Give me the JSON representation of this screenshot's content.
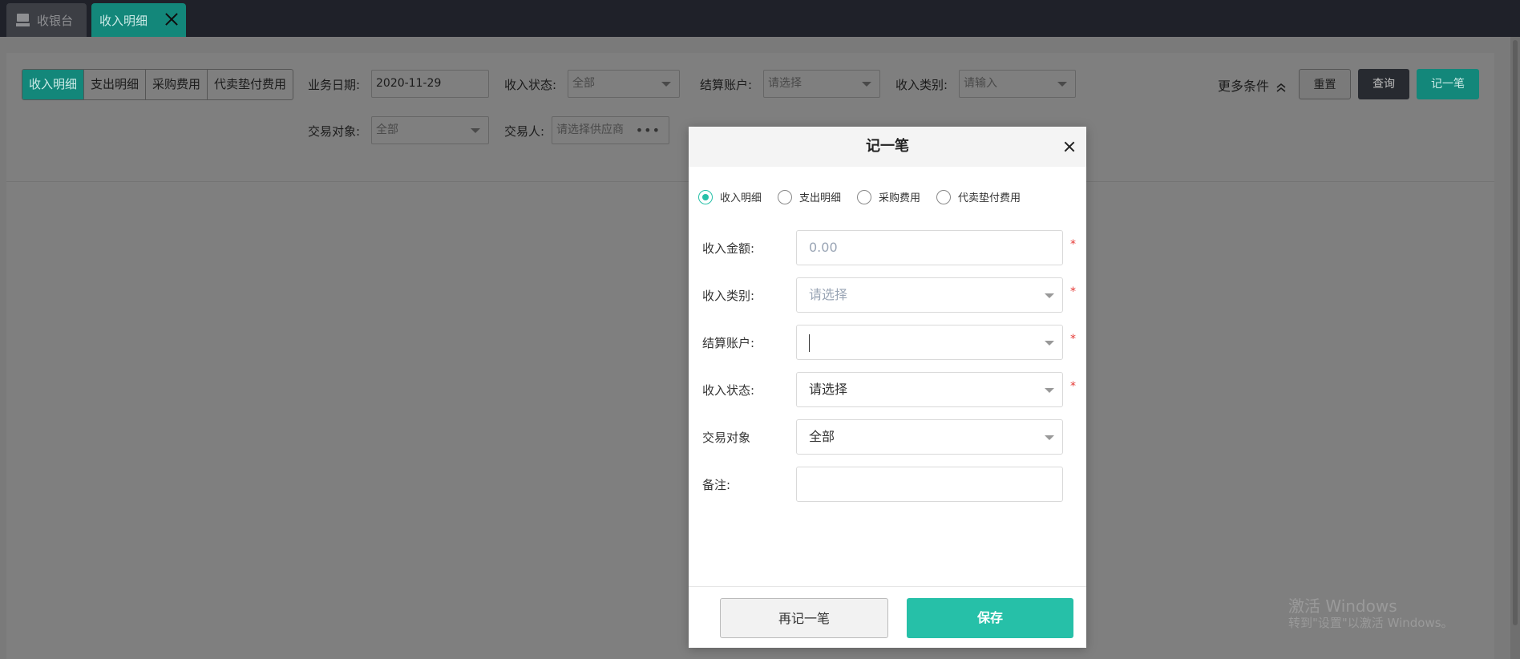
{
  "tabs": [
    {
      "label": "收银台",
      "icon": "cash-register-icon"
    },
    {
      "label": "收入明细",
      "active": true
    }
  ],
  "filter": {
    "segments": [
      "收入明细",
      "支出明细",
      "采购费用",
      "代卖垫付费用"
    ],
    "active_segment": "收入明细",
    "biz_date_label": "业务日期:",
    "biz_date_value": "2020-11-29",
    "income_status_label": "收入状态:",
    "income_status_value": "全部",
    "account_label": "结算账户:",
    "account_placeholder": "请选择",
    "category_label": "收入类别:",
    "category_placeholder": "请输入",
    "object_label": "交易对象:",
    "object_value": "全部",
    "trader_label": "交易人:",
    "trader_placeholder": "请选择供应商",
    "trader_dots": "•••",
    "more_label": "更多条件",
    "reset_label": "重置",
    "query_label": "查询",
    "record_label": "记一笔"
  },
  "modal": {
    "title": "记一笔",
    "types": [
      "收入明细",
      "支出明细",
      "采购费用",
      "代卖垫付费用"
    ],
    "selected_type": "收入明细",
    "amount_label": "收入金额:",
    "amount_placeholder": "0.00",
    "category_label": "收入类别:",
    "category_placeholder": "请选择",
    "account_label": "结算账户:",
    "account_value": "",
    "status_label": "收入状态:",
    "status_value": "请选择",
    "object_label": "交易对象",
    "object_value": "全部",
    "remark_label": "备注:",
    "remark_value": "",
    "required_mark": "*",
    "again_label": "再记一笔",
    "save_label": "保存"
  },
  "watermark": {
    "line1": "激活 Windows",
    "line2": "转到\"设置\"以激活 Windows。"
  },
  "colors": {
    "accent": "#26c0a8",
    "accent_dimmed": "#13877a",
    "required": "#e53935"
  }
}
